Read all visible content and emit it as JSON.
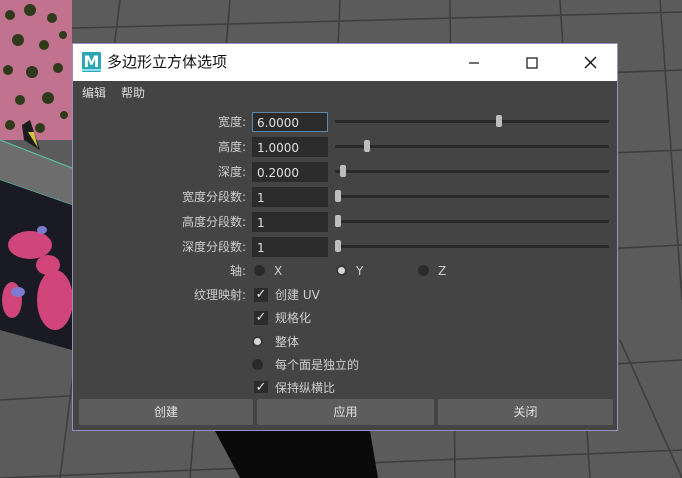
{
  "dialog": {
    "title": "多边形立方体选项",
    "logo_letter": "M",
    "window_buttons": {
      "minimize": "minimize-icon",
      "maximize": "maximize-icon",
      "close": "close-icon"
    }
  },
  "menu": {
    "items": [
      "编辑",
      "帮助"
    ]
  },
  "fields": [
    {
      "label": "宽度:",
      "value": "6.0000",
      "slider_fraction": 0.6
    },
    {
      "label": "高度:",
      "value": "1.0000",
      "slider_fraction": 0.11
    },
    {
      "label": "深度:",
      "value": "0.2000",
      "slider_fraction": 0.02
    },
    {
      "label": "宽度分段数:",
      "value": "1",
      "slider_fraction": 0.0
    },
    {
      "label": "高度分段数:",
      "value": "1",
      "slider_fraction": 0.0
    },
    {
      "label": "深度分段数:",
      "value": "1",
      "slider_fraction": 0.0
    }
  ],
  "axis": {
    "label": "轴:",
    "options": [
      "X",
      "Y",
      "Z"
    ],
    "selected": "Y"
  },
  "texture_mapping": {
    "label": "纹理映射:",
    "create_uv": {
      "label": "创建 UV",
      "checked": true
    },
    "normalize": {
      "label": "规格化",
      "checked": true
    },
    "mode_options": [
      {
        "label": "整体",
        "selected": true
      },
      {
        "label": "每个面是独立的",
        "selected": false
      }
    ],
    "keep_ratio": {
      "label": "保持纵横比",
      "checked": true
    }
  },
  "footer": {
    "create_label": "创建",
    "apply_label": "应用",
    "close_label": "关闭"
  },
  "colors": {
    "dialog_bg": "#444444",
    "field_bg": "#2b2b2b",
    "active_field_border": "#5e87a8",
    "button_bg": "#5d5d5d",
    "logo": "#2da7b7"
  }
}
